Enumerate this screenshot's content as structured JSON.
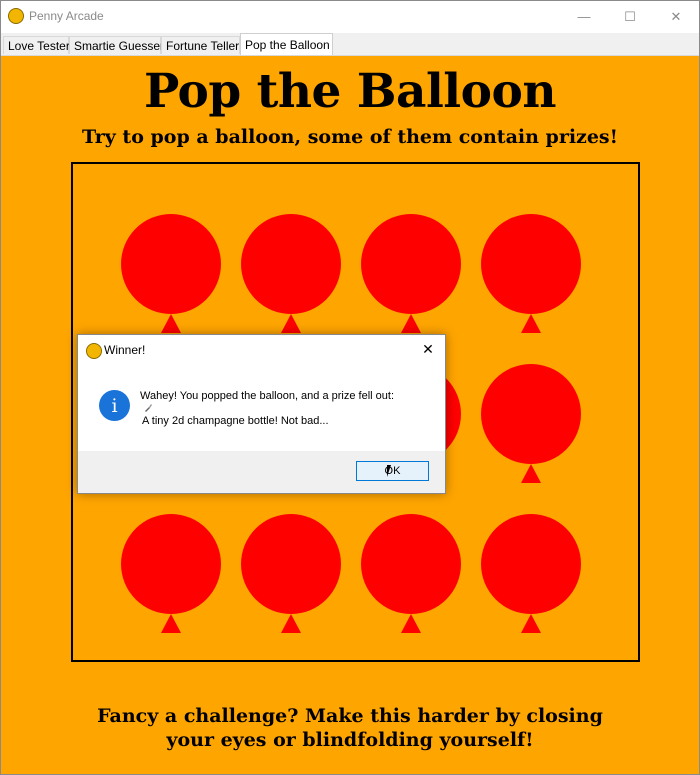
{
  "window": {
    "title": "Penny Arcade",
    "controls": {
      "minimize": "—",
      "maximize": "☐",
      "close": "✕"
    }
  },
  "tabs": [
    {
      "label": "Love Tester",
      "active": false
    },
    {
      "label": "Smartie Guesser",
      "active": false
    },
    {
      "label": "Fortune Teller",
      "active": false
    },
    {
      "label": "Pop the Balloon",
      "active": true
    }
  ],
  "game": {
    "heading": "Pop the Balloon",
    "subheading": "Try to pop a balloon, some of them contain prizes!",
    "footer_line1": "Fancy a challenge? Make this harder by closing",
    "footer_line2": "your eyes or blindfolding yourself!",
    "background_color": "#ffa500",
    "balloon_color": "#ff0000",
    "balloon_grid": {
      "rows": 3,
      "columns": 4
    }
  },
  "dialog": {
    "title": "Winner!",
    "close_glyph": "✕",
    "icon": "info-icon",
    "message_line1": "Wahey! You popped the balloon, and a prize fell out:",
    "message_line2": "A tiny 2d champagne bottle! Not bad...",
    "ok_label": "OK"
  }
}
